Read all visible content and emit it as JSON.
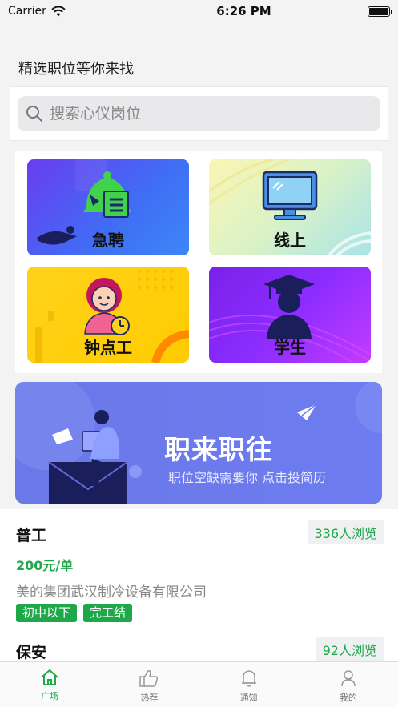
{
  "status_bar": {
    "carrier": "Carrier",
    "time": "6:26 PM"
  },
  "section_title": "精选职位等你来找",
  "search": {
    "placeholder": "搜索心仪岗位"
  },
  "categories": [
    {
      "label": "急聘",
      "icon": "bell-list-icon"
    },
    {
      "label": "线上",
      "icon": "monitor-icon"
    },
    {
      "label": "钟点工",
      "icon": "worker-clock-icon"
    },
    {
      "label": "学生",
      "icon": "graduate-icon"
    }
  ],
  "banner": {
    "title": "职来职往",
    "subtitle": "职位空缺需要你  点击投简历"
  },
  "jobs": [
    {
      "title": "普工",
      "views": "336人浏览",
      "salary": "200元/单",
      "company": "美的集团武汉制冷设备有限公司",
      "tags": [
        "初中以下",
        "完工结"
      ]
    },
    {
      "title": "保安",
      "views": "92人浏览"
    }
  ],
  "tabbar": [
    {
      "label": "广场",
      "icon": "home-icon"
    },
    {
      "label": "热荐",
      "icon": "thumbs-up-icon"
    },
    {
      "label": "通知",
      "icon": "bell-icon"
    },
    {
      "label": "我的",
      "icon": "user-icon"
    }
  ],
  "colors": {
    "accent": "#1ea84a",
    "banner": "#6a78e8"
  }
}
